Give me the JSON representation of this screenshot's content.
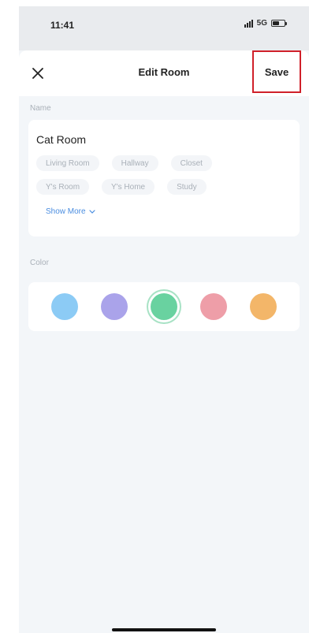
{
  "status_bar": {
    "time": "11:41",
    "network": "5G"
  },
  "header": {
    "title": "Edit Room",
    "close_icon": "close-icon",
    "save_label": "Save"
  },
  "name_section": {
    "label": "Name",
    "value": "Cat Room",
    "suggestions_row1": [
      "Living Room",
      "Hallway",
      "Closet"
    ],
    "suggestions_row2": [
      "Y's Room",
      "Y's Home",
      "Study"
    ],
    "show_more_label": "Show More"
  },
  "color_section": {
    "label": "Color",
    "swatches": [
      {
        "color": "#8ccbf5",
        "selected": false
      },
      {
        "color": "#aaa3ea",
        "selected": false
      },
      {
        "color": "#69d2a0",
        "selected": true
      },
      {
        "color": "#ee9ea8",
        "selected": false
      },
      {
        "color": "#f3b669",
        "selected": false
      }
    ]
  },
  "accent_colors": {
    "save_highlight": "#d0202a",
    "link": "#4a8de0"
  }
}
